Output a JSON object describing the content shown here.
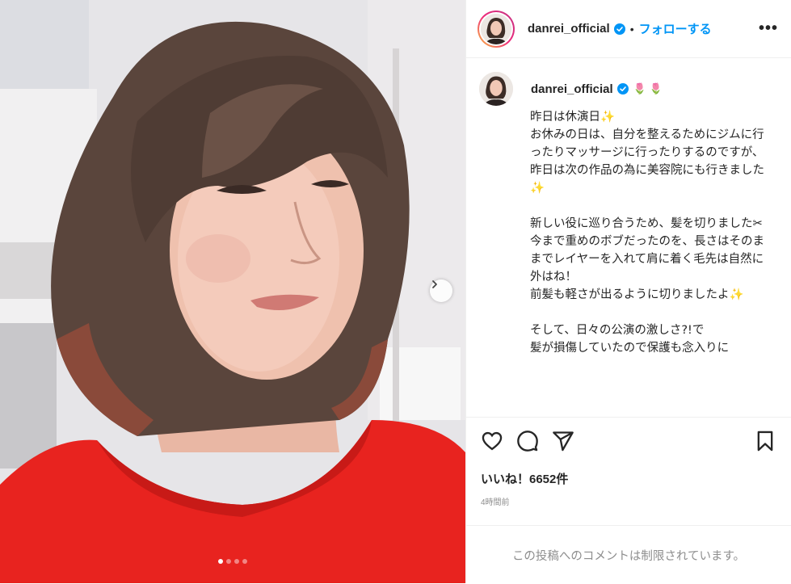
{
  "post": {
    "username": "danrei_official",
    "separator": "•",
    "follow_label": "フォローする",
    "more_label": "•••",
    "caption_emoji": "🌷 🌷",
    "caption": "昨日は休演日✨\nお休みの日は、自分を整えるためにジムに行ったりマッサージに行ったりするのですが、\n昨日は次の作品の為に美容院にも行きました✨\n\n新しい役に巡り合うため、髪を切りました✂\n今まで重めのボブだったのを、長さはそのままでレイヤーを入れて肩に着く毛先は自然に\n外はね！\n前髪も軽さが出るように切りましたよ✨\n\nそして、日々の公演の激しさ?!で\n髪が損傷していたので保護も念入りに",
    "likes": "いいね！6652件",
    "timestamp": "4時間前",
    "comment_restricted": "この投稿へのコメントは制限されています。"
  },
  "carousel": {
    "current": 1,
    "total": 4
  },
  "colors": {
    "accent": "#0095f6",
    "verified": "#0095f6",
    "shirt": "#e8231f"
  },
  "icons": [
    "verified-badge-icon",
    "more-icon",
    "heart-icon",
    "comment-icon",
    "share-icon",
    "bookmark-icon",
    "chevron-right-icon"
  ]
}
